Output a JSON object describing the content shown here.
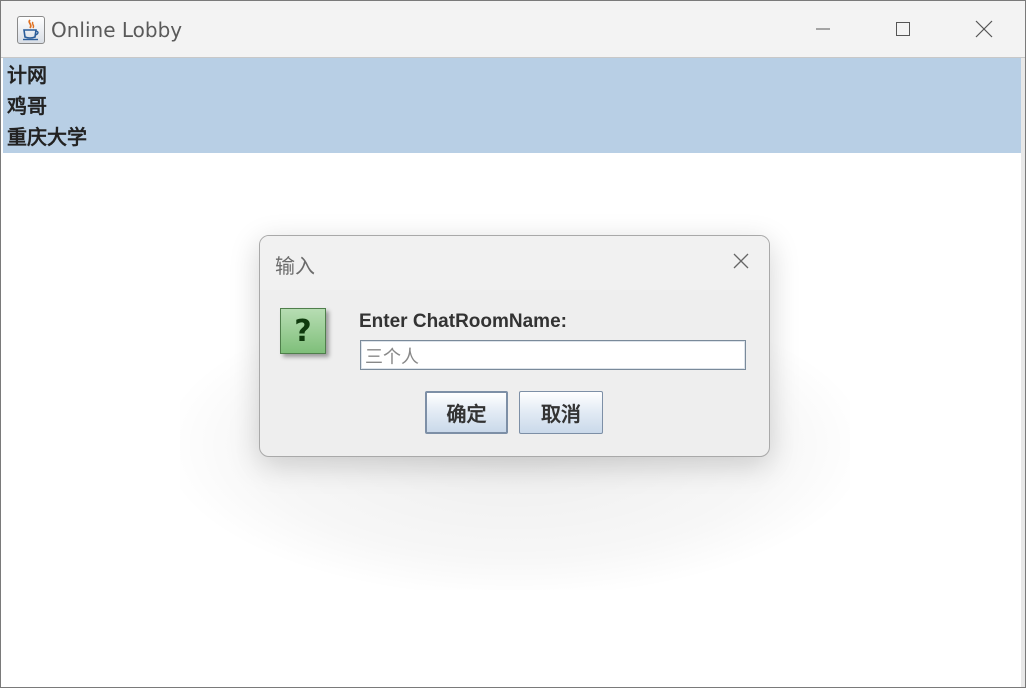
{
  "window": {
    "title": "Online Lobby",
    "icon": "java-cup-icon"
  },
  "lobby_list": {
    "items": [
      {
        "label": "计网"
      },
      {
        "label": "鸡哥"
      },
      {
        "label": "重庆大学"
      }
    ],
    "selection_color": "#b8cfe5"
  },
  "dialog": {
    "title": "输入",
    "icon": "question-icon",
    "icon_glyph": "?",
    "prompt": "Enter ChatRoomName:",
    "input": {
      "value": "三个人"
    },
    "ok_label": "确定",
    "cancel_label": "取消"
  }
}
